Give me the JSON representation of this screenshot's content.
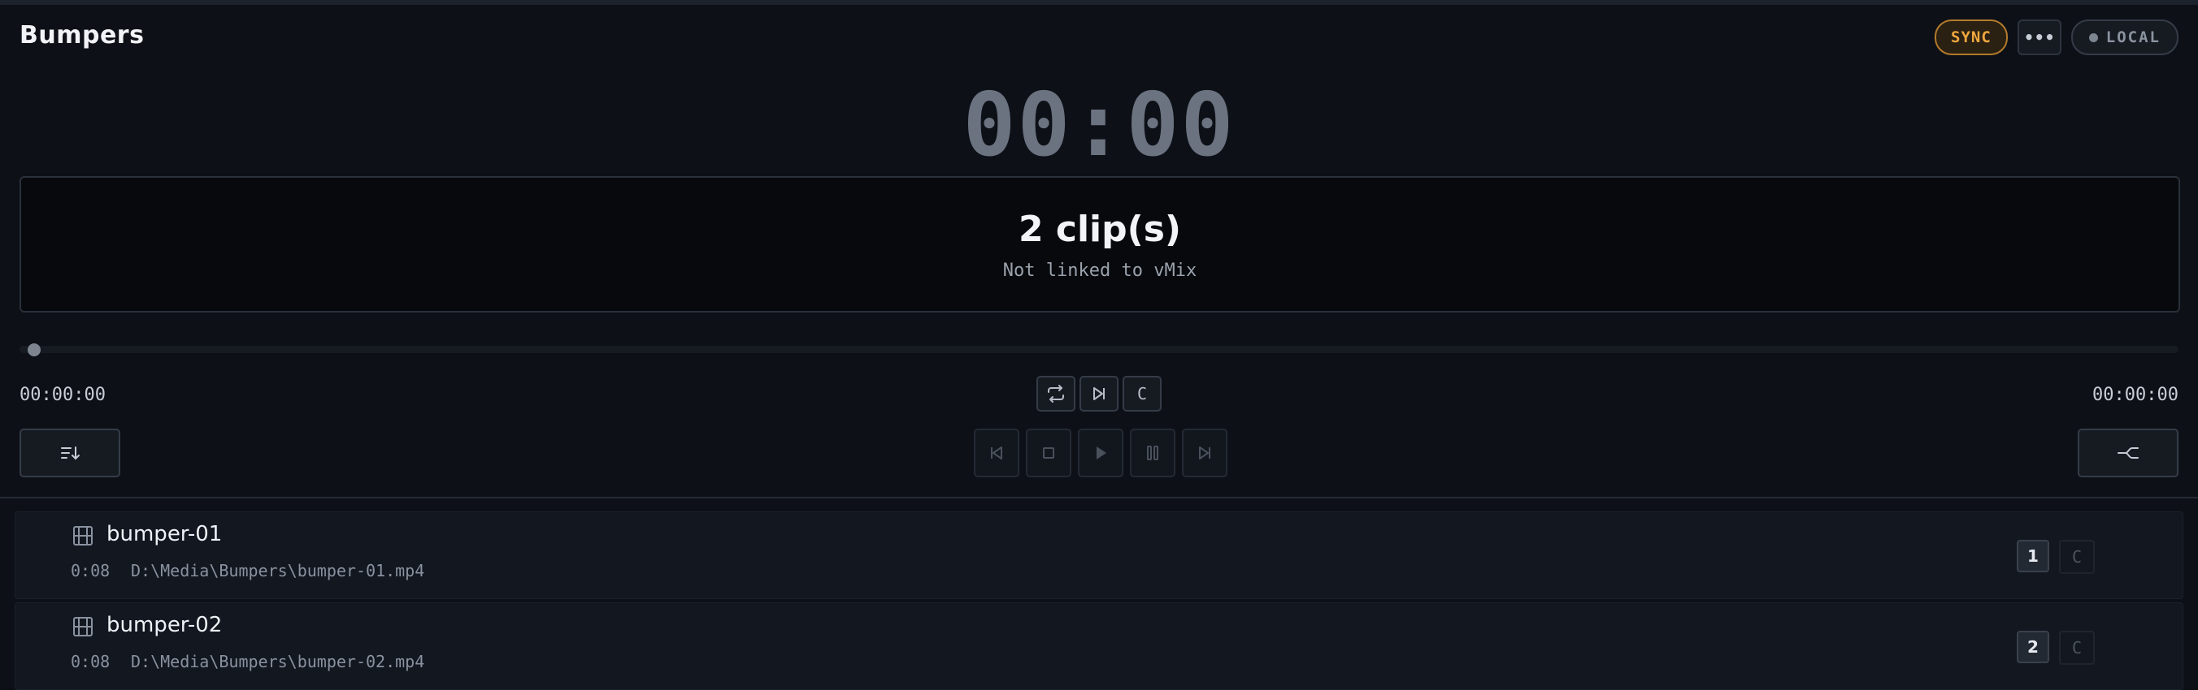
{
  "header": {
    "title": "Bumpers",
    "sync_label": "SYNC",
    "more_label": "•••",
    "local_label": "LOCAL"
  },
  "clock": "00:00",
  "status": {
    "title": "2 clip(s)",
    "subtitle": "Not linked to vMix"
  },
  "timeline": {
    "progress_fraction": 0,
    "elapsed": "00:00:00",
    "remaining": "00:00:00"
  },
  "mini_controls": {
    "c_label": "C"
  },
  "clips": [
    {
      "name": "bumper-01",
      "duration": "0:08",
      "path": "D:\\Media\\Bumpers\\bumper-01.mp4",
      "number": "1",
      "c_label": "C"
    },
    {
      "name": "bumper-02",
      "duration": "0:08",
      "path": "D:\\Media\\Bumpers\\bumper-02.mp4",
      "number": "2",
      "c_label": "C"
    }
  ],
  "colors": {
    "accent": "#f0a63f",
    "background": "#0d1117",
    "muted": "#6b7280"
  }
}
